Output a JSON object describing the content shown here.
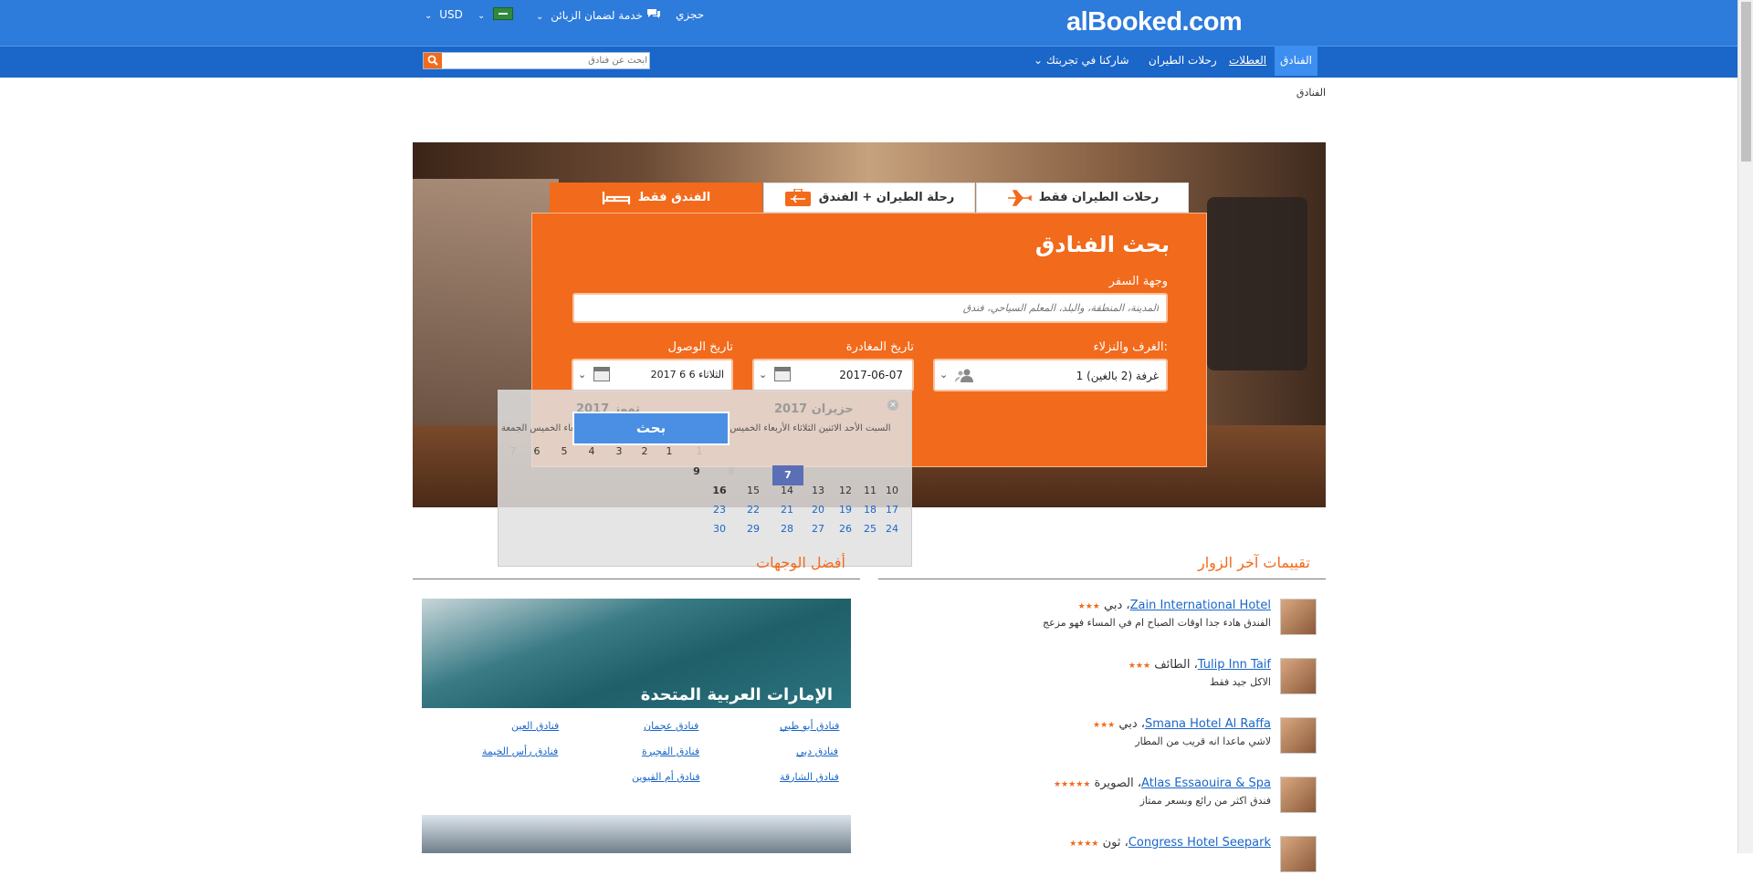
{
  "header": {
    "logo": "alBooked.com",
    "my_booking": "حجزي",
    "guarantee": "خدمة لضمان الزبائن",
    "currency": "USD"
  },
  "nav": {
    "hotels": "الفنادق",
    "holidays": "العطلات",
    "flights": "رحلات الطيران",
    "share": "شاركنا في تجربتك",
    "search_placeholder": "ابحث عن فنادق"
  },
  "breadcrumb": "الفنادق",
  "tabs": {
    "flights_only": "رحلات الطيران فقط",
    "flight_hotel": "رحلة الطيران + الفندق",
    "hotel_only": "الفندق فقط"
  },
  "search_form": {
    "title": "بحث الفنادق",
    "destination_label": "وجهة السفر",
    "destination_placeholder": "المدينة، المنطقة، والبلد، المعلم السياحي، فندق",
    "rooms_label": "الغرف والنزلاء:",
    "rooms_value": "1 غرفة (2 بالغين)",
    "checkout_label": "تاريخ المغادرة",
    "checkout_value": "2017-06-07",
    "checkin_label": "تاريخ الوصول",
    "checkin_value": "الثلاثاء 6 6 2017",
    "search_button": "بحث"
  },
  "datepicker": {
    "month1": "حزيران 2017",
    "month2": "تموز 2017",
    "weekdays1": "السبت الأحد الاثنين الثلاثاء الأربعاء الخميس الجمعة",
    "weekdays2": "السبت الأحد الاثنين الثلاثاء الأربعاء الخميس الجمعة",
    "selected_day": "7",
    "close": "×"
  },
  "sections": {
    "reviews_title": "تقييمات آخر الزوار",
    "destinations_title": "أفضل الوجهات"
  },
  "reviews": [
    {
      "hotel": "Zain International Hotel",
      "city": "، دبي",
      "stars": "★★★",
      "text": "الفندق هادء جدا اوقات الصباح ام في المساء فهو مزعج"
    },
    {
      "hotel": "Tulip Inn Taif",
      "city": "، الطائف",
      "stars": "★★★",
      "text": "الاكل جيد فقط"
    },
    {
      "hotel": "Smana Hotel Al Raffa",
      "city": "، دبي",
      "stars": "★★★",
      "text": "لاشي ماعدا انه قريب من المطار"
    },
    {
      "hotel": "Atlas Essaouira & Spa",
      "city": "، الصويرة",
      "stars": "★★★★★",
      "text": "فندق اكثر من رائع وبسعر ممتاز"
    },
    {
      "hotel": "Congress Hotel Seepark",
      "city": "، ثون",
      "stars": "★★★★",
      "text": ""
    }
  ],
  "destination": {
    "caption": "الإمارات العربية المتحدة",
    "links": [
      "فنادق أبو ظبي",
      "فنادق عجمان",
      "فنادق العين",
      "فنادق دبي",
      "فنادق الفجيرة",
      "فنادق رأس الخيمة",
      "فنادق الشارقة",
      "فنادق أم القيوين"
    ]
  },
  "colors": {
    "topbar": "#2d7bdb",
    "navbar": "#1a66c9",
    "accent": "#f26a1b",
    "link": "#1a66c9"
  },
  "icons": [
    "chat-icon",
    "flag-icon",
    "search-icon",
    "airplane-icon",
    "luggage-icon",
    "bed-icon",
    "calendar-icon",
    "user-icon"
  ]
}
